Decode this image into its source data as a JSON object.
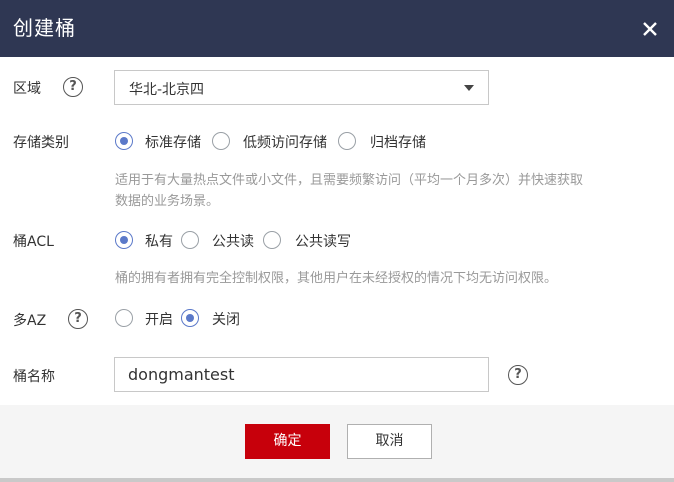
{
  "dialog": {
    "title": "创建桶",
    "close_icon": "close-icon"
  },
  "colors": {
    "header_bg": "#2f3753",
    "accent": "#5b79c9",
    "primary_button": "#c7000b"
  },
  "region": {
    "label": "区域",
    "value": "华北-北京四"
  },
  "storage_class": {
    "label": "存储类别",
    "options": [
      "标准存储",
      "低频访问存储",
      "归档存储"
    ],
    "selected": "标准存储",
    "description_line1": "适用于有大量热点文件或小文件，且需要频繁访问（平均一个月多次）并快速获取",
    "description_line2": "数据的业务场景。"
  },
  "acl": {
    "label": "桶ACL",
    "options": [
      "私有",
      "公共读",
      "公共读写"
    ],
    "selected": "私有",
    "description": "桶的拥有者拥有完全控制权限，其他用户在未经授权的情况下均无访问权限。"
  },
  "multi_az": {
    "label": "多AZ",
    "options": [
      "开启",
      "关闭"
    ],
    "selected": "关闭"
  },
  "bucket_name": {
    "label": "桶名称",
    "value": "dongmantest"
  },
  "footer": {
    "ok_label": "确定",
    "cancel_label": "取消"
  }
}
